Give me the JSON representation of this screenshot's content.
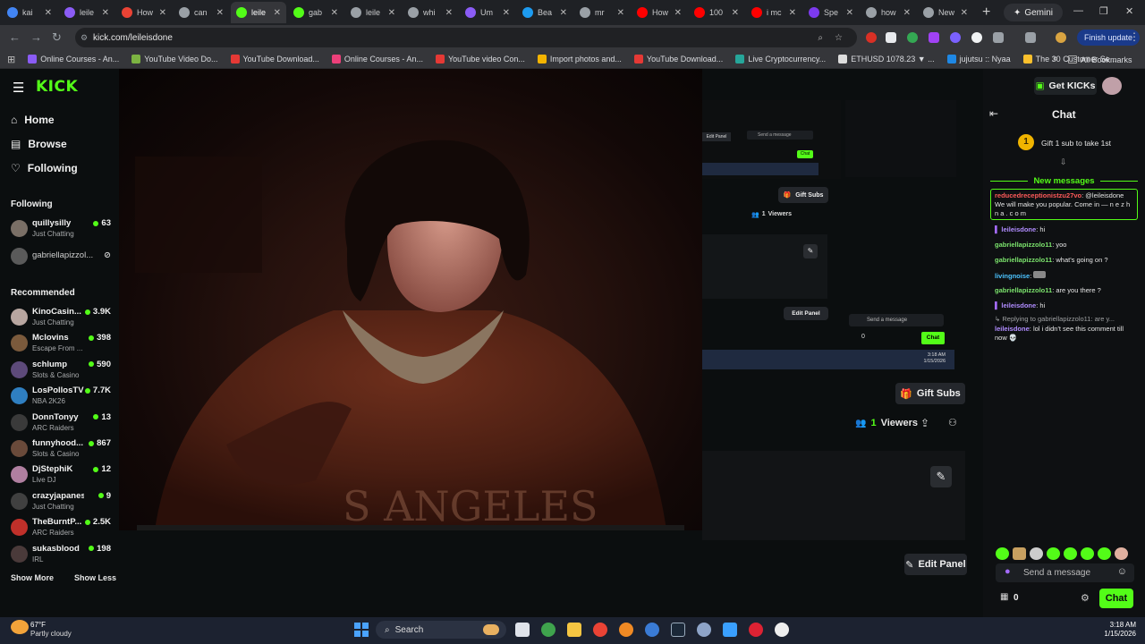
{
  "browser": {
    "tabs": [
      {
        "title": "kai",
        "color": "#4285f4"
      },
      {
        "title": "leile",
        "color": "#8b5cf6"
      },
      {
        "title": "How",
        "color": "#ea4335"
      },
      {
        "title": "can",
        "color": "#9aa0a6"
      },
      {
        "title": "leile",
        "color": "#53fc18",
        "active": true
      },
      {
        "title": "gab",
        "color": "#53fc18"
      },
      {
        "title": "leile",
        "color": "#9aa0a6"
      },
      {
        "title": "whi",
        "color": "#9aa0a6"
      },
      {
        "title": "Um",
        "color": "#8b5cf6"
      },
      {
        "title": "Bea",
        "color": "#1d9bf0"
      },
      {
        "title": "mr",
        "color": "#9aa0a6"
      },
      {
        "title": "How",
        "color": "#ff0000"
      },
      {
        "title": "100",
        "color": "#ff0000"
      },
      {
        "title": "i mc",
        "color": "#ff0000"
      },
      {
        "title": "Spe",
        "color": "#7c3aed"
      },
      {
        "title": "how",
        "color": "#9aa0a6"
      },
      {
        "title": "New",
        "color": "#9aa0a6"
      }
    ],
    "gemini_label": "Gemini",
    "url": "kick.com/leileisdone",
    "finish_update": "Finish update",
    "bookmarks": [
      {
        "label": "Online Courses - An...",
        "color": "#8b5cf6"
      },
      {
        "label": "YouTube Video Do...",
        "color": "#7cb342"
      },
      {
        "label": "YouTube Download...",
        "color": "#e53935"
      },
      {
        "label": "Online Courses - An...",
        "color": "#ec407a"
      },
      {
        "label": "YouTube video Con...",
        "color": "#e53935"
      },
      {
        "label": "Import photos and...",
        "color": "#f4b400"
      },
      {
        "label": "YouTube Download...",
        "color": "#e53935"
      },
      {
        "label": "Live Cryptocurrency...",
        "color": "#26a69a"
      },
      {
        "label": "ETHUSD 1078.23 ▼ ...",
        "color": "#dddddd"
      },
      {
        "label": "jujutsu :: Nyaa",
        "color": "#1e88e5"
      },
      {
        "label": "The 30 Customer Se...",
        "color": "#fbc02d"
      }
    ],
    "all_bookmarks": "All Bookmarks"
  },
  "kick": {
    "logo": "KICK",
    "nav": {
      "home": "Home",
      "browse": "Browse",
      "following": "Following"
    },
    "following_title": "Following",
    "following": [
      {
        "name": "quillysilly",
        "category": "Just Chatting",
        "viewers": "63"
      },
      {
        "name": "gabriellapizzol...",
        "category": "",
        "viewers": ""
      }
    ],
    "recommended_title": "Recommended",
    "recommended": [
      {
        "name": "KinoCasin...",
        "category": "Just Chatting",
        "viewers": "3.9K"
      },
      {
        "name": "Mclovins",
        "category": "Escape From ...",
        "viewers": "398"
      },
      {
        "name": "schlump",
        "category": "Slots & Casino",
        "viewers": "590"
      },
      {
        "name": "LosPollosTV",
        "category": "NBA 2K26",
        "viewers": "7.7K"
      },
      {
        "name": "DonnTonyy",
        "category": "ARC Raiders",
        "viewers": "13"
      },
      {
        "name": "funnyhood...",
        "category": "Slots & Casino",
        "viewers": "867"
      },
      {
        "name": "DjStephiK",
        "category": "Live DJ",
        "viewers": "12"
      },
      {
        "name": "crazyjapanese",
        "category": "Just Chatting",
        "viewers": "9"
      },
      {
        "name": "TheBurntP...",
        "category": "ARC Raiders",
        "viewers": "2.5K"
      },
      {
        "name": "sukasblood",
        "category": "IRL",
        "viewers": "198"
      }
    ],
    "show_more": "Show More",
    "show_less": "Show Less",
    "get_kicks": "Get KICKs",
    "gift_subs": "Gift Subs",
    "viewers_count": "1",
    "viewers_label": "Viewers",
    "edit_panel": "Edit Panel",
    "chat": {
      "title": "Chat",
      "gift_prompt": "Gift 1 sub to take 1st",
      "gift_rank": "1",
      "new_messages": "New messages",
      "messages": [
        {
          "user": "reducedreceptionistzu27vo",
          "text": "@leileisdone We will make you popular. Come in — n e z h n a . c o m",
          "color": "#ff5a5a",
          "highlight": true
        },
        {
          "user": "leileisdone",
          "text": "hi",
          "color": "#b08cff"
        },
        {
          "user": "gabriellapizzolo11",
          "text": "yoo",
          "color": "#7be36c"
        },
        {
          "user": "gabriellapizzolo11",
          "text": "what's going on ?",
          "color": "#7be36c"
        },
        {
          "user": "livingnoise",
          "text": "",
          "color": "#4cc3ff"
        },
        {
          "user": "gabriellapizzolo11",
          "text": "are you there ?",
          "color": "#7be36c"
        },
        {
          "user": "leileisdone",
          "text": "hi",
          "color": "#b08cff"
        }
      ],
      "reply_to": "Replying to gabriellapizzolo11: are y...",
      "reply_user": "leileisdone",
      "reply_text": "lol i didn't see this comment till now 💀",
      "input_placeholder": "Send a message",
      "points": "0",
      "chat_button": "Chat"
    },
    "mini": {
      "time": "3:18 AM",
      "date": "1/15/2026"
    }
  },
  "taskbar": {
    "weather_temp": "67°F",
    "weather_desc": "Partly cloudy",
    "search": "Search",
    "time": "3:18 AM",
    "date": "1/15/2026"
  }
}
